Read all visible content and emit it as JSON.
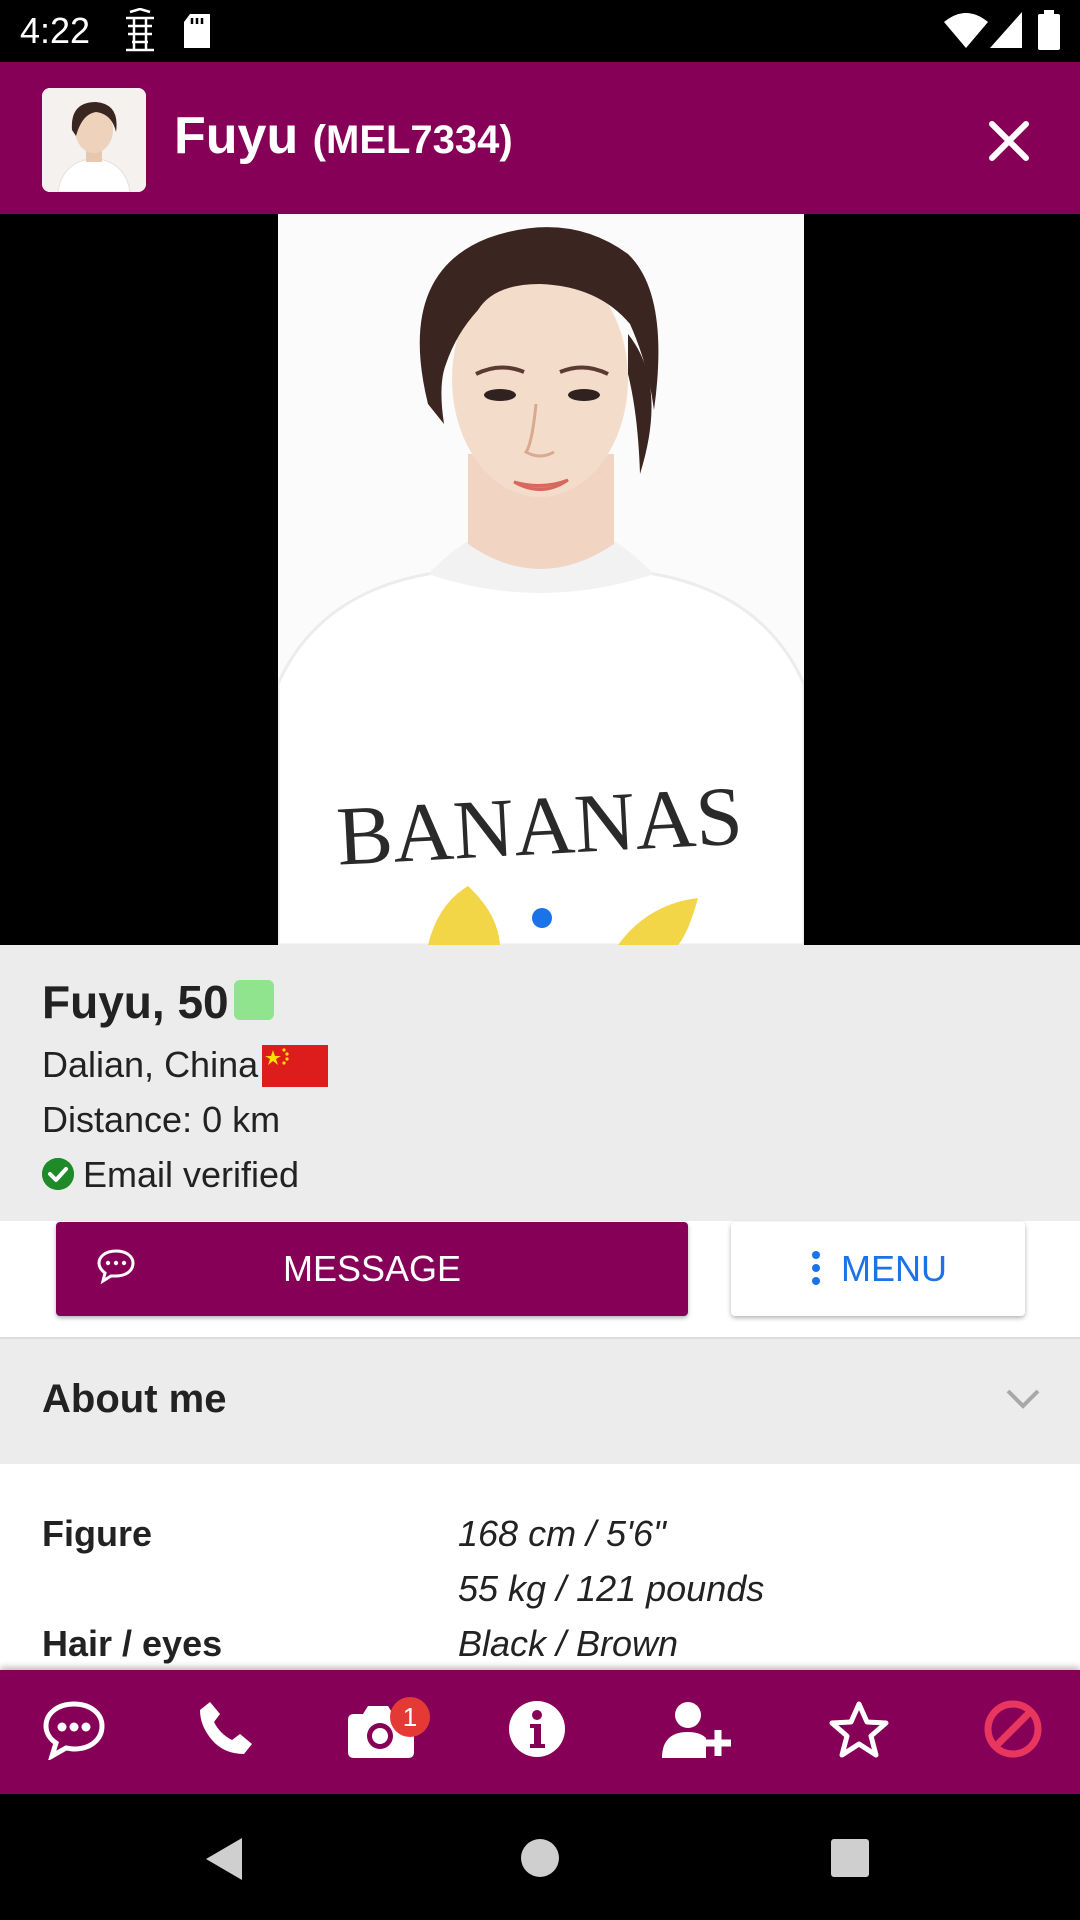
{
  "status_bar": {
    "time": "4:22"
  },
  "header": {
    "name": "Fuyu",
    "member_id": "(MEL7334)"
  },
  "photo": {
    "shirt_text": "BANANAS",
    "page_count": 1,
    "current_page": 1
  },
  "profile": {
    "name_age": "Fuyu, 50",
    "location": "Dalian, China",
    "distance": "Distance: 0 km",
    "verification": "Email verified",
    "online_color": "#90e48e"
  },
  "actions": {
    "message_label": "MESSAGE",
    "menu_label": "MENU"
  },
  "about": {
    "title": "About me",
    "details": [
      {
        "label": "Figure",
        "values": [
          "168 cm / 5'6\"",
          "55 kg / 121 pounds"
        ]
      },
      {
        "label": "Hair / eyes",
        "values": [
          "Black / Brown"
        ]
      }
    ]
  },
  "bottom_nav": {
    "items": [
      "chat-icon",
      "phone-icon",
      "camera-icon",
      "info-icon",
      "add-contact-icon",
      "star-icon",
      "block-icon"
    ],
    "photo_badge": "1"
  },
  "colors": {
    "brand": "#860057",
    "accent_blue": "#1a73e8",
    "block_red": "#e8365e",
    "badge_red": "#e53935"
  }
}
